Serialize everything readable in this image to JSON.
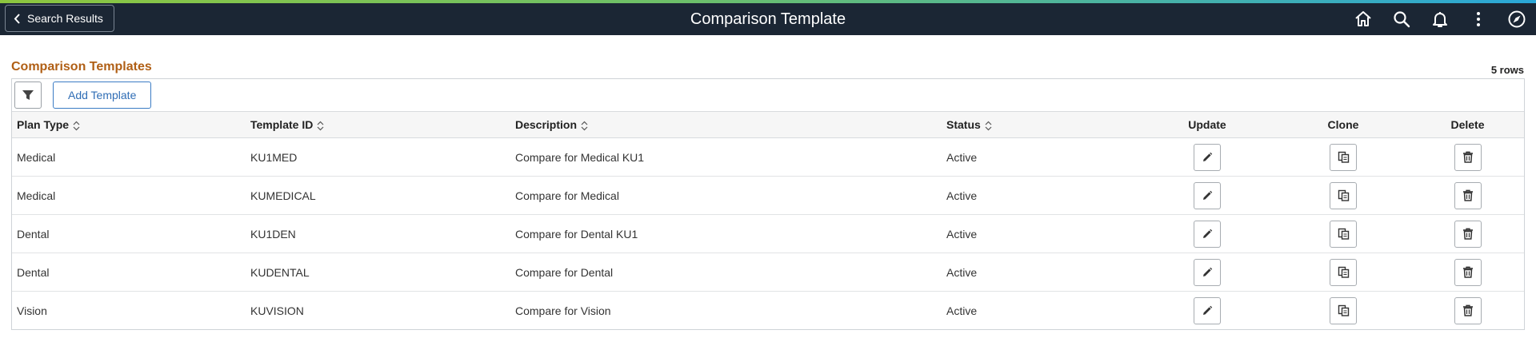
{
  "header": {
    "back_label": "Search Results",
    "title": "Comparison Template",
    "icons": [
      "home-icon",
      "search-icon",
      "notifications-bell-icon",
      "actions-menu-icon",
      "navbar-compass-icon"
    ]
  },
  "grid": {
    "title": "Comparison Templates",
    "row_count": "5 rows",
    "add_label": "Add Template",
    "columns": {
      "plan_type": "Plan Type",
      "template_id": "Template ID",
      "description": "Description",
      "status": "Status",
      "update": "Update",
      "clone": "Clone",
      "delete": "Delete"
    },
    "rows": [
      {
        "plan_type": "Medical",
        "template_id": "KU1MED",
        "description": "Compare for Medical KU1",
        "status": "Active"
      },
      {
        "plan_type": "Medical",
        "template_id": "KUMEDICAL",
        "description": "Compare for Medical",
        "status": "Active"
      },
      {
        "plan_type": "Dental",
        "template_id": "KU1DEN",
        "description": "Compare for Dental KU1",
        "status": "Active"
      },
      {
        "plan_type": "Dental",
        "template_id": "KUDENTAL",
        "description": "Compare for Dental",
        "status": "Active"
      },
      {
        "plan_type": "Vision",
        "template_id": "KUVISION",
        "description": "Compare for Vision",
        "status": "Active"
      }
    ]
  },
  "colors": {
    "header_bg": "#1b2634",
    "grid_title": "#b05f15",
    "add_button": "#2f6db5"
  }
}
